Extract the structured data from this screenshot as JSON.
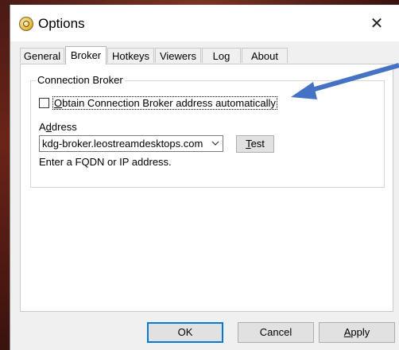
{
  "window": {
    "title": "Options"
  },
  "tabs": [
    {
      "label": "General"
    },
    {
      "label": "Broker",
      "active": true
    },
    {
      "label": "Hotkeys"
    },
    {
      "label": "Viewers"
    },
    {
      "label": "Log"
    },
    {
      "label": "About"
    }
  ],
  "broker": {
    "group_label": "Connection Broker",
    "auto_checkbox": {
      "checked": false,
      "label_key": "O",
      "label_rest": "btain Connection Broker address automatically"
    },
    "address_label_pre": "A",
    "address_label_key": "d",
    "address_label_post": "dress",
    "address_value": "kdg-broker.leostreamdesktops.com",
    "test_label_key": "T",
    "test_label_rest": "est",
    "hint": "Enter a FQDN or IP address."
  },
  "buttons": {
    "ok": "OK",
    "cancel": "Cancel",
    "apply_key": "A",
    "apply_rest": "pply"
  },
  "colors": {
    "arrow": "#4472c4",
    "focus": "#0078d7",
    "desktop": "#5a1e14"
  }
}
